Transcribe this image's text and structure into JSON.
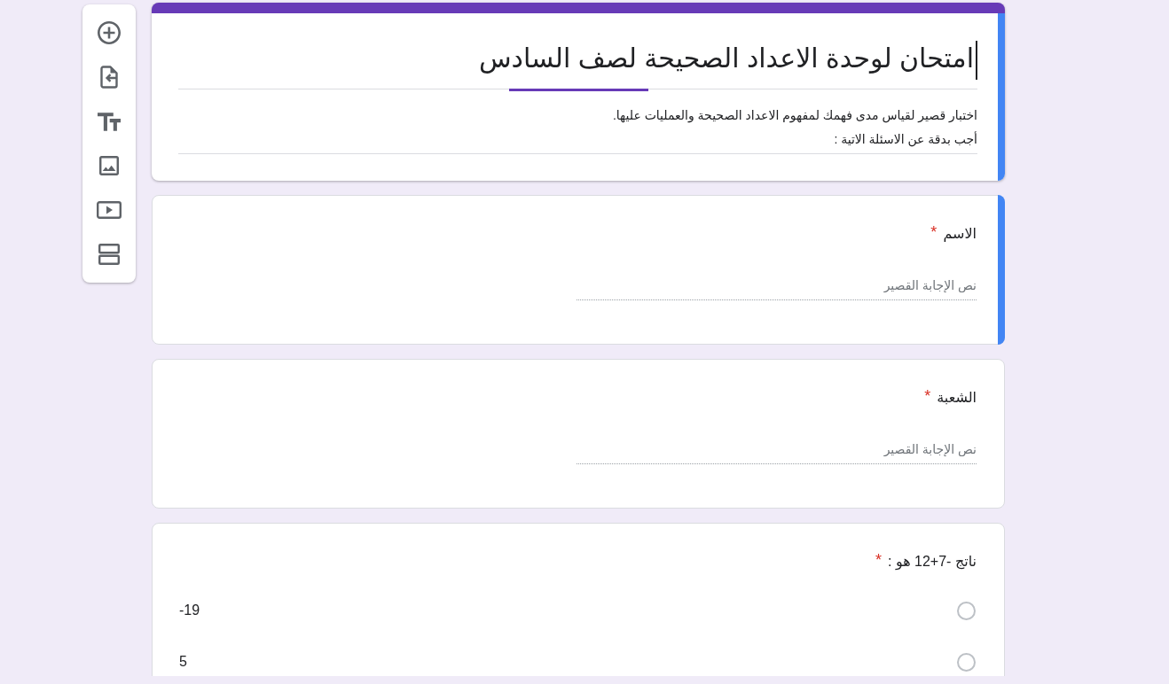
{
  "header": {
    "focused": true,
    "editing": true,
    "title": "امتحان لوحدة الاعداد الصحيحة لصف السادس",
    "description": "اختبار قصير لقياس مدى فهمك لمفهوم الاعداد الصحيحة والعمليات عليها.\nأجب بدقة عن الاسئلة الاتية :"
  },
  "questions": [
    {
      "kind": "short_answer",
      "focused": true,
      "label": "الاسم",
      "required_mark": "*",
      "placeholder": "نص الإجابة القصير"
    },
    {
      "kind": "short_answer",
      "focused": false,
      "label": "الشعبة",
      "required_mark": "*",
      "placeholder": "نص الإجابة القصير"
    },
    {
      "kind": "multiple_choice",
      "focused": false,
      "label": "ناتج -7+12 هو :",
      "required_mark": "*",
      "options": [
        {
          "label": "-19",
          "selected": false
        },
        {
          "label": "5",
          "selected": false
        }
      ]
    }
  ]
}
